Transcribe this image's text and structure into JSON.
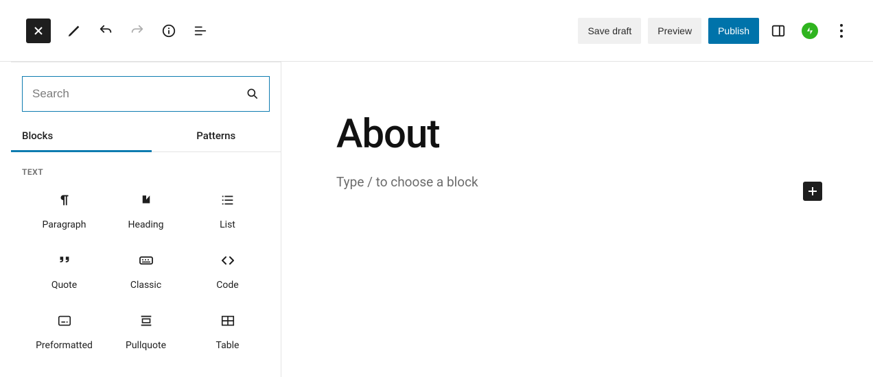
{
  "toolbar": {
    "save_draft": "Save draft",
    "preview": "Preview",
    "publish": "Publish"
  },
  "sidebar": {
    "search_placeholder": "Search",
    "tabs": {
      "blocks": "Blocks",
      "patterns": "Patterns"
    },
    "category": "TEXT",
    "blocks": [
      {
        "id": "paragraph",
        "label": "Paragraph"
      },
      {
        "id": "heading",
        "label": "Heading"
      },
      {
        "id": "list",
        "label": "List"
      },
      {
        "id": "quote",
        "label": "Quote"
      },
      {
        "id": "classic",
        "label": "Classic"
      },
      {
        "id": "code",
        "label": "Code"
      },
      {
        "id": "preformatted",
        "label": "Preformatted"
      },
      {
        "id": "pullquote",
        "label": "Pullquote"
      },
      {
        "id": "table",
        "label": "Table"
      }
    ]
  },
  "content": {
    "title": "About",
    "placeholder": "Type / to choose a block"
  }
}
